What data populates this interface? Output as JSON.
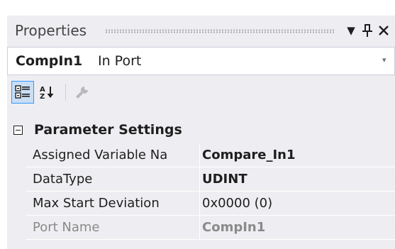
{
  "panel": {
    "title": "Properties",
    "buttons": {
      "dropdown_glyph": "▼",
      "pin_glyph": "ᛘ",
      "close_glyph": "✕"
    }
  },
  "selector": {
    "object_name": "CompIn1",
    "object_type": "In Port",
    "caret": "▾"
  },
  "toolbar": {
    "icons": [
      "categorized-icon",
      "alphabetical-icon",
      "property-pages-icon"
    ]
  },
  "category": {
    "label": "Parameter Settings",
    "expanded": true
  },
  "properties": [
    {
      "name": "Assigned Variable Na",
      "value": "Compare_In1",
      "value_bold": true,
      "readonly": false
    },
    {
      "name": "DataType",
      "value": "UDINT",
      "value_bold": true,
      "readonly": false
    },
    {
      "name": "Max Start Deviation",
      "value": "0x0000 (0)",
      "value_bold": false,
      "readonly": false
    },
    {
      "name": "Port Name",
      "value": "CompIn1",
      "value_bold": true,
      "readonly": true
    }
  ],
  "colors": {
    "background": "#eeeef2",
    "selected_tool": "#c9def5",
    "selected_border": "#3399ff",
    "readonly_text": "#8a8a8a"
  }
}
